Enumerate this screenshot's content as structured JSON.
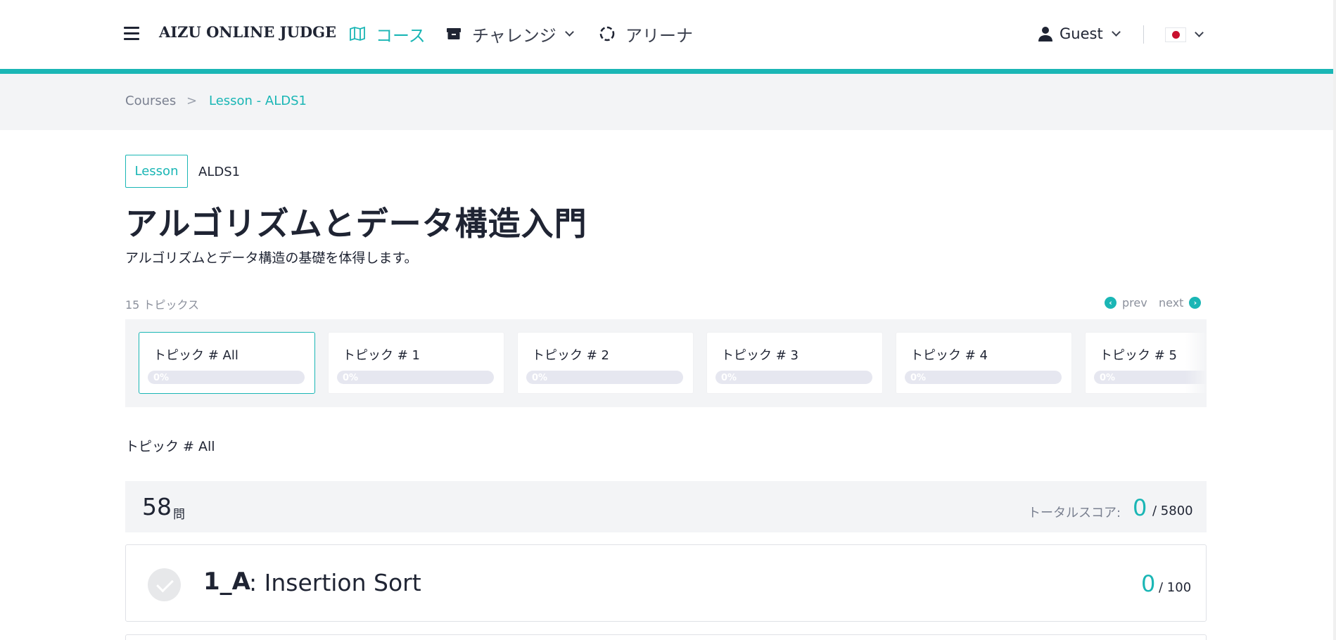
{
  "header": {
    "brand": "AIZU ONLINE JUDGE",
    "nav": {
      "course": "コース",
      "challenge": "チャレンジ",
      "arena": "アリーナ"
    },
    "user": "Guest"
  },
  "breadcrumb": {
    "courses": "Courses",
    "separator": ">",
    "lesson": "Lesson - ALDS1"
  },
  "lesson": {
    "badge": "Lesson",
    "id": "ALDS1",
    "title": "アルゴリズムとデータ構造入門",
    "description": "アルゴリズムとデータ構造の基礎を体得します。"
  },
  "topics": {
    "count_label": "15 トピックス",
    "prev": "prev",
    "next": "next",
    "items": [
      {
        "name": "トピック # All",
        "progress": "0%"
      },
      {
        "name": "トピック # 1",
        "progress": "0%"
      },
      {
        "name": "トピック # 2",
        "progress": "0%"
      },
      {
        "name": "トピック # 3",
        "progress": "0%"
      },
      {
        "name": "トピック # 4",
        "progress": "0%"
      },
      {
        "name": "トピック # 5",
        "progress": "0%"
      }
    ],
    "selected_label": "トピック # All"
  },
  "summary": {
    "count": "58",
    "count_unit": "問",
    "total_label": "トータルスコア:",
    "total_score": "0",
    "total_max": "/ 5800"
  },
  "problems": [
    {
      "id": "1_A",
      "name": ": Insertion Sort",
      "score": "0",
      "max": "/ 100"
    }
  ],
  "colors": {
    "accent": "#1ab6b5",
    "text": "#1f2433",
    "muted": "#7a8090",
    "band": "#f3f4f6"
  },
  "icons": {
    "menu": "hamburger-icon",
    "course": "map-icon",
    "challenge": "box-icon",
    "arena": "dashed-circle-icon",
    "user": "user-icon",
    "lang": "japan-flag-icon"
  }
}
